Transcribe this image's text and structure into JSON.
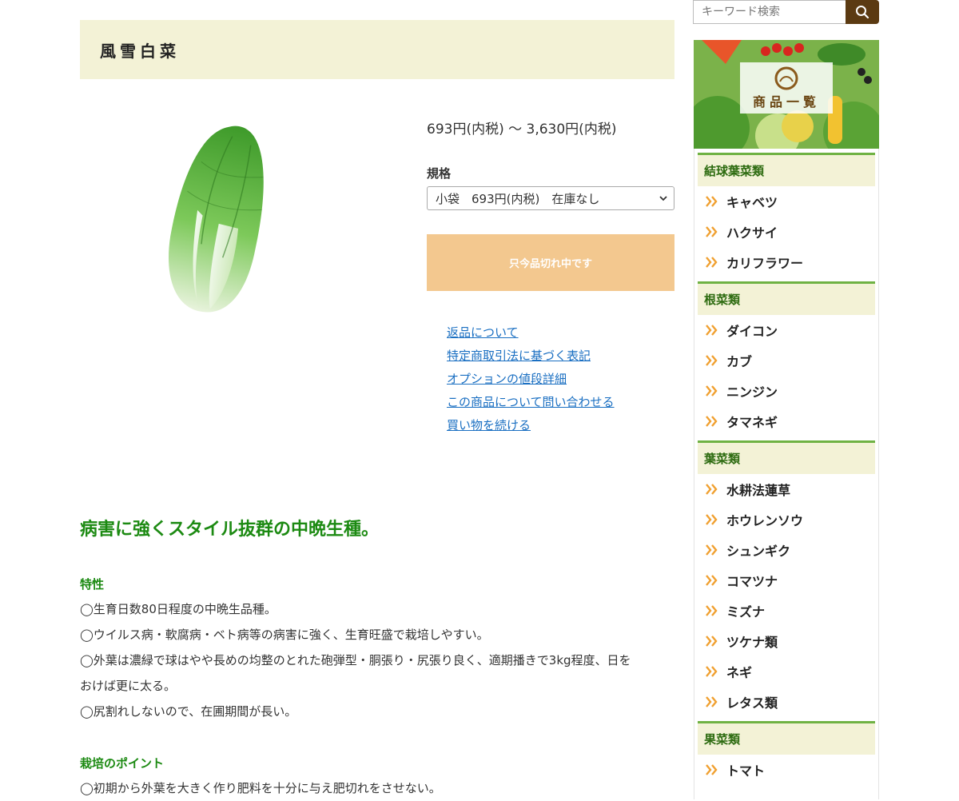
{
  "product": {
    "title": "風雪白菜",
    "price_range": "693円(内税) 〜 3,630円(内税)",
    "spec_label": "規格",
    "spec_selected": "小袋　693円(内税)　在庫なし",
    "soldout_label": "只今品切れ中です",
    "links": [
      "返品について",
      "特定商取引法に基づく表記",
      "オプションの値段詳細",
      "この商品について問い合わせる",
      "買い物を続ける"
    ]
  },
  "description": {
    "headline": "病害に強くスタイル抜群の中晩生種。",
    "section1_title": "特性",
    "section1_lines": [
      "◯生育日数80日程度の中晩生品種。",
      "◯ウイルス病・軟腐病・ベト病等の病害に強く、生育旺盛で栽培しやすい。",
      "◯外葉は濃緑で球はやや長めの均整のとれた砲弾型・胴張り・尻張り良く、適期播きで3kg程度、日を",
      "おけば更に太る。",
      "◯尻割れしないので、在圃期間が長い。"
    ],
    "section2_title": "栽培のポイント",
    "section2_lines": [
      "◯初期から外葉を大きく作り肥料を十分に与え肥切れをさせない。"
    ]
  },
  "sidebar": {
    "search_placeholder": "キーワード検索",
    "banner_text": "商品一覧",
    "categories": [
      {
        "name": "結球葉菜類",
        "items": [
          "キャベツ",
          "ハクサイ",
          "カリフラワー"
        ]
      },
      {
        "name": "根菜類",
        "items": [
          "ダイコン",
          "カブ",
          "ニンジン",
          "タマネギ"
        ]
      },
      {
        "name": "葉菜類",
        "items": [
          "水耕法蓮草",
          "ホウレンソウ",
          "シュンギク",
          "コマツナ",
          "ミズナ",
          "ツケナ類",
          "ネギ",
          "レタス類"
        ]
      },
      {
        "name": "果菜類",
        "items": [
          "トマト"
        ]
      }
    ]
  },
  "colors": {
    "title_bg": "#f3f2d6",
    "soldout_bg": "#f3c88f",
    "headline_green": "#1c8a12",
    "link_blue": "#1a6fc2",
    "search_button": "#5b3a12",
    "category_border": "#6fb243",
    "chevron_orange": "#f0a030"
  }
}
